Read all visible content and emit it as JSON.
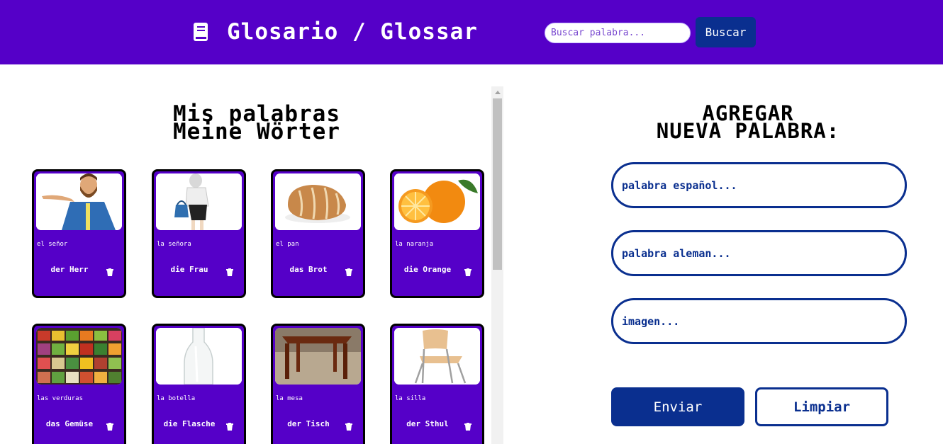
{
  "header": {
    "title": "Glosario / Glossar",
    "search_placeholder": "Buscar palabra...",
    "search_button": "Buscar",
    "icon": "book-icon",
    "background": "#5500c8"
  },
  "left": {
    "title_line1": "Mis palabras",
    "title_line2": "Meine Wörter"
  },
  "cards": [
    {
      "es": "el señor",
      "de": "der Herr",
      "image": "man-presenting"
    },
    {
      "es": "la señora",
      "de": "die Frau",
      "image": "woman-with-handbag"
    },
    {
      "es": "el pan",
      "de": "das Brot",
      "image": "bread-loaf"
    },
    {
      "es": "la naranja",
      "de": "die Orange",
      "image": "oranges"
    },
    {
      "es": "las verduras",
      "de": "das Gemüse",
      "image": "vegetable-stand"
    },
    {
      "es": "la botella",
      "de": "die Flasche",
      "image": "glass-bottle"
    },
    {
      "es": "la mesa",
      "de": "der Tisch",
      "image": "wooden-table"
    },
    {
      "es": "la silla",
      "de": "der Sthul",
      "image": "chair"
    }
  ],
  "form": {
    "title_line1": "AGREGAR",
    "title_line2": "NUEVA PALABRA:",
    "spanish_placeholder": "palabra español...",
    "german_placeholder": "palabra aleman...",
    "image_placeholder": "imagen...",
    "send_button": "Enviar",
    "clear_button": "Limpiar"
  },
  "colors": {
    "primary": "#5500c8",
    "accent": "#0a2f8f"
  }
}
